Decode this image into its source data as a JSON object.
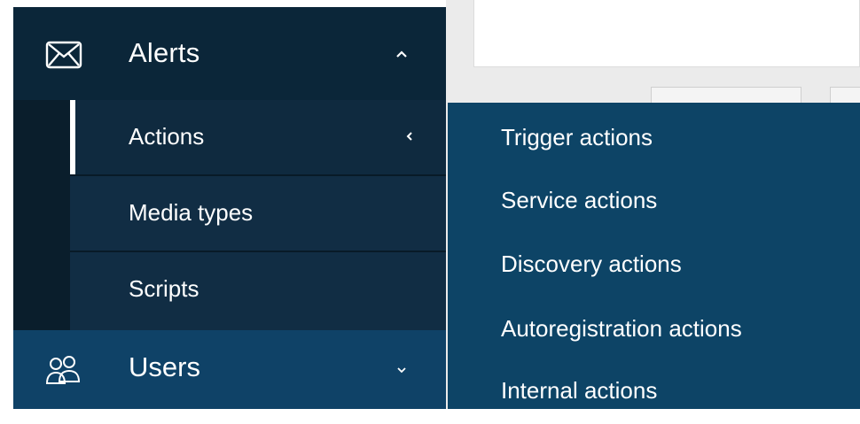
{
  "sidebar": {
    "alerts": {
      "label": "Alerts",
      "icon": "envelope-icon",
      "chevron": "chevron-up-icon",
      "submenu": [
        {
          "label": "Actions",
          "active": true,
          "has_flyout": true
        },
        {
          "label": "Media types"
        },
        {
          "label": "Scripts"
        }
      ]
    },
    "users": {
      "label": "Users",
      "icon": "users-icon",
      "chevron": "chevron-down-icon"
    }
  },
  "flyout": {
    "items": [
      "Trigger actions",
      "Service actions",
      "Discovery actions",
      "Autoregistration actions",
      "Internal actions"
    ]
  },
  "colors": {
    "sidebar_dark": "#0b2639",
    "submenu_bg": "#112d44",
    "flyout_bg": "#0d4466",
    "users_bg": "#0f4267",
    "text": "#ffffff"
  }
}
